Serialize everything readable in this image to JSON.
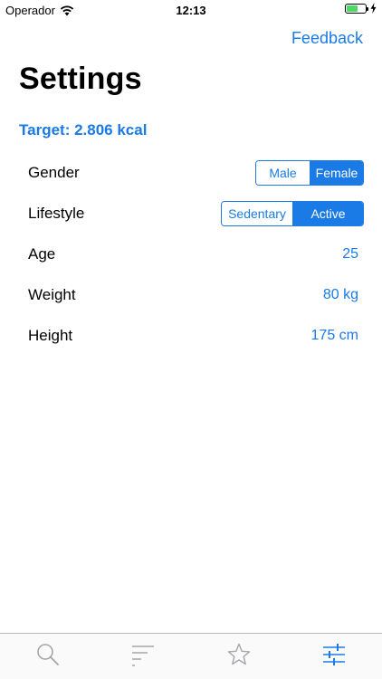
{
  "status_bar": {
    "carrier": "Operador",
    "time": "12:13",
    "battery_level": 0.6
  },
  "header": {
    "feedback_label": "Feedback",
    "title": "Settings"
  },
  "target": {
    "text": "Target: 2.806 kcal"
  },
  "settings": {
    "gender": {
      "label": "Gender",
      "options": [
        "Male",
        "Female"
      ],
      "selected": "Female"
    },
    "lifestyle": {
      "label": "Lifestyle",
      "options": [
        "Sedentary",
        "Active"
      ],
      "selected": "Active"
    },
    "age": {
      "label": "Age",
      "value": "25"
    },
    "weight": {
      "label": "Weight",
      "value": "80 kg"
    },
    "height": {
      "label": "Height",
      "value": "175 cm"
    }
  },
  "tab_bar": {
    "tabs": [
      {
        "icon": "search-icon"
      },
      {
        "icon": "list-icon"
      },
      {
        "icon": "star-icon"
      },
      {
        "icon": "sliders-icon",
        "active": true
      }
    ]
  },
  "colors": {
    "accent": "#1a7ae6",
    "tab_inactive": "#a6a6aa",
    "battery": "#4cd964"
  }
}
